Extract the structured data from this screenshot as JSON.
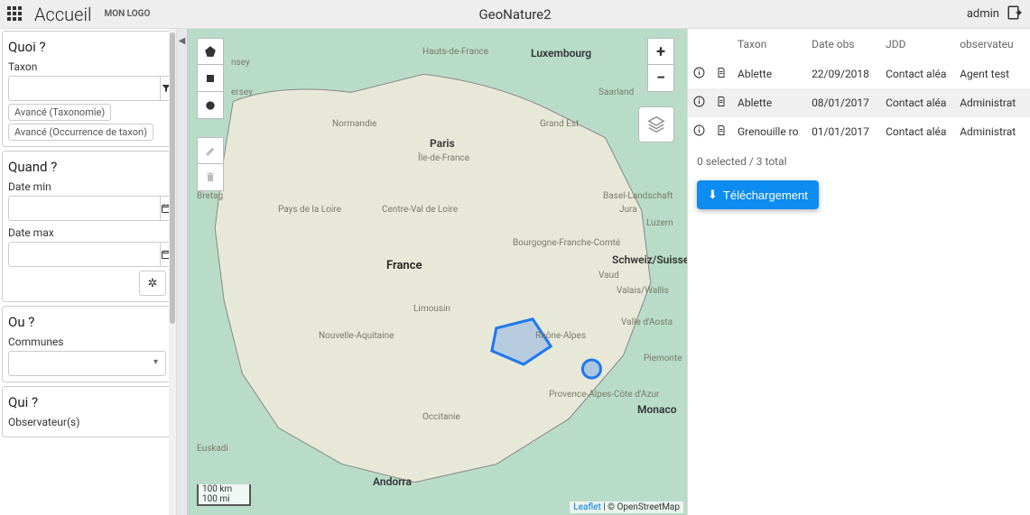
{
  "topbar": {
    "home": "Accueil",
    "logo": "MON LOGO",
    "app_title": "GeoNature2",
    "user": "admin"
  },
  "sidebar": {
    "quoi": {
      "title": "Quoi ?",
      "taxon_label": "Taxon",
      "chip_taxonomie": "Avancé (Taxonomie)",
      "chip_occurrence": "Avancé (Occurrence de taxon)"
    },
    "quand": {
      "title": "Quand ?",
      "date_min_label": "Date min",
      "date_max_label": "Date max"
    },
    "ou": {
      "title": "Ou ?",
      "communes_label": "Communes"
    },
    "qui": {
      "title": "Qui ?",
      "observateurs_label": "Observateur(s)"
    }
  },
  "map": {
    "scale_km": "100 km",
    "scale_mi": "100 mi",
    "attrib_leaflet": "Leaflet",
    "attrib_sep": " | © ",
    "attrib_osm": "OpenStreetMap",
    "labels": {
      "france": "France",
      "paris": "Paris",
      "luxembourg": "Luxembourg",
      "andorra": "Andorra",
      "monaco": "Monaco",
      "schweiz": "Schweiz/Suisse/Svizzera/S",
      "jersey": "ersey",
      "nsey": "nsey",
      "hauts": "Hauts-de-France",
      "normandie": "Normandie",
      "idf": "Île-de-France",
      "grand_est": "Grand Est",
      "bretagne": "Bretag",
      "pdl": "Pays de la Loire",
      "cvl": "Centre-Val de Loire",
      "bfc": "Bourgogne-Franche-Comté",
      "na": "Nouvelle-Aquitaine",
      "limousin": "Limousin",
      "ara": "Rhône-Alpes",
      "occ": "Occitanie",
      "paca": "Provence-Alpes-Côte d'Azur",
      "euskadi": "Euskadi",
      "saarland": "Saarland",
      "basel": "Basel-Landschaft",
      "jura": "Jura",
      "luzern": "Luzern",
      "vaud": "Vaud",
      "valais": "Valais/Wallis",
      "aosta": "Valle d'Aosta",
      "piemonte": "Piemonte"
    }
  },
  "table": {
    "headers": {
      "taxon": "Taxon",
      "date_obs": "Date obs",
      "jdd": "JDD",
      "observateur": "observateu"
    },
    "rows": [
      {
        "taxon": "Ablette",
        "date": "22/09/2018",
        "jdd": "Contact aléa",
        "obs": "Agent test"
      },
      {
        "taxon": "Ablette",
        "date": "08/01/2017",
        "jdd": "Contact aléa",
        "obs": "Administrat"
      },
      {
        "taxon": "Grenouille ro",
        "date": "01/01/2017",
        "jdd": "Contact aléa",
        "obs": "Administrat"
      }
    ],
    "status": "0 selected / 3 total",
    "download": "Téléchargement"
  }
}
